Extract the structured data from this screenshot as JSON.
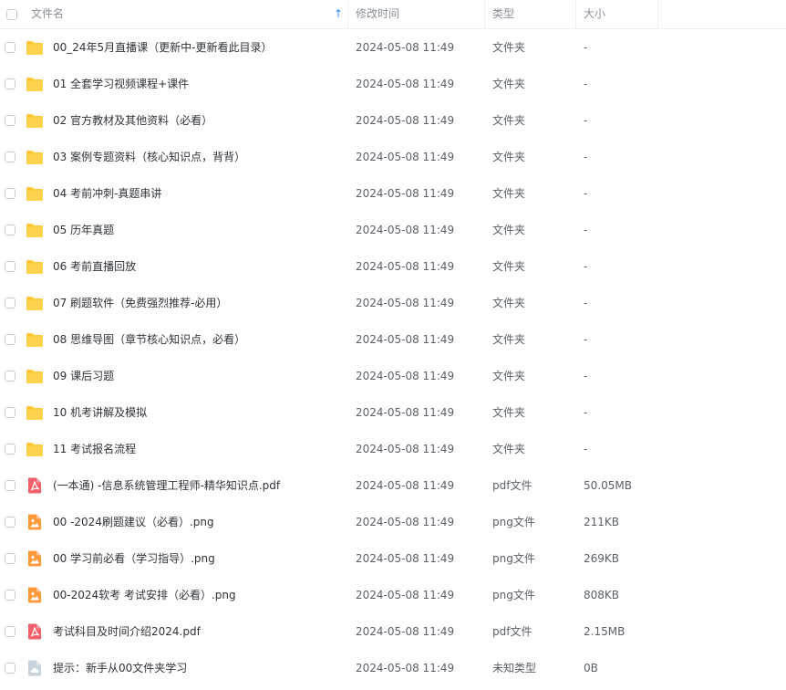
{
  "header": {
    "name_label": "文件名",
    "modified_label": "修改时间",
    "type_label": "类型",
    "size_label": "大小",
    "sort_glyph": "↑"
  },
  "rows": [
    {
      "name": "00_24年5月直播课（更新中-更新看此目录）",
      "modified": "2024-05-08 11:49",
      "type": "文件夹",
      "size": "-",
      "icon": "folder-icon"
    },
    {
      "name": "01 全套学习视频课程+课件",
      "modified": "2024-05-08 11:49",
      "type": "文件夹",
      "size": "-",
      "icon": "folder-icon"
    },
    {
      "name": "02 官方教材及其他资料（必看）",
      "modified": "2024-05-08 11:49",
      "type": "文件夹",
      "size": "-",
      "icon": "folder-icon"
    },
    {
      "name": "03 案例专题资料（核心知识点，背背）",
      "modified": "2024-05-08 11:49",
      "type": "文件夹",
      "size": "-",
      "icon": "folder-icon"
    },
    {
      "name": "04 考前冲刺-真题串讲",
      "modified": "2024-05-08 11:49",
      "type": "文件夹",
      "size": "-",
      "icon": "folder-icon"
    },
    {
      "name": "05 历年真题",
      "modified": "2024-05-08 11:49",
      "type": "文件夹",
      "size": "-",
      "icon": "folder-icon"
    },
    {
      "name": "06 考前直播回放",
      "modified": "2024-05-08 11:49",
      "type": "文件夹",
      "size": "-",
      "icon": "folder-icon"
    },
    {
      "name": "07 刷题软件（免费强烈推荐-必用）",
      "modified": "2024-05-08 11:49",
      "type": "文件夹",
      "size": "-",
      "icon": "folder-icon"
    },
    {
      "name": "08 思维导图（章节核心知识点，必看）",
      "modified": "2024-05-08 11:49",
      "type": "文件夹",
      "size": "-",
      "icon": "folder-icon"
    },
    {
      "name": "09 课后习题",
      "modified": "2024-05-08 11:49",
      "type": "文件夹",
      "size": "-",
      "icon": "folder-icon"
    },
    {
      "name": "10 机考讲解及模拟",
      "modified": "2024-05-08 11:49",
      "type": "文件夹",
      "size": "-",
      "icon": "folder-icon"
    },
    {
      "name": "11 考试报名流程",
      "modified": "2024-05-08 11:49",
      "type": "文件夹",
      "size": "-",
      "icon": "folder-icon"
    },
    {
      "name": "(一本通) -信息系统管理工程师-精华知识点.pdf",
      "modified": "2024-05-08 11:49",
      "type": "pdf文件",
      "size": "50.05MB",
      "icon": "pdf-icon"
    },
    {
      "name": "00 -2024刷题建议（必看）.png",
      "modified": "2024-05-08 11:49",
      "type": "png文件",
      "size": "211KB",
      "icon": "image-icon"
    },
    {
      "name": "00 学习前必看（学习指导）.png",
      "modified": "2024-05-08 11:49",
      "type": "png文件",
      "size": "269KB",
      "icon": "image-icon"
    },
    {
      "name": "00-2024软考 考试安排（必看）.png",
      "modified": "2024-05-08 11:49",
      "type": "png文件",
      "size": "808KB",
      "icon": "image-icon"
    },
    {
      "name": "考试科目及时间介绍2024.pdf",
      "modified": "2024-05-08 11:49",
      "type": "pdf文件",
      "size": "2.15MB",
      "icon": "pdf-icon"
    },
    {
      "name": "提示：新手从00文件夹学习",
      "modified": "2024-05-08 11:49",
      "type": "未知类型",
      "size": "0B",
      "icon": "unknown-file-icon"
    }
  ],
  "colors": {
    "folder": "#ffc93c",
    "pdf": "#f2616b",
    "image": "#ff9a3c",
    "unknown": "#c9d3de",
    "sort_accent": "#2f8cff"
  }
}
